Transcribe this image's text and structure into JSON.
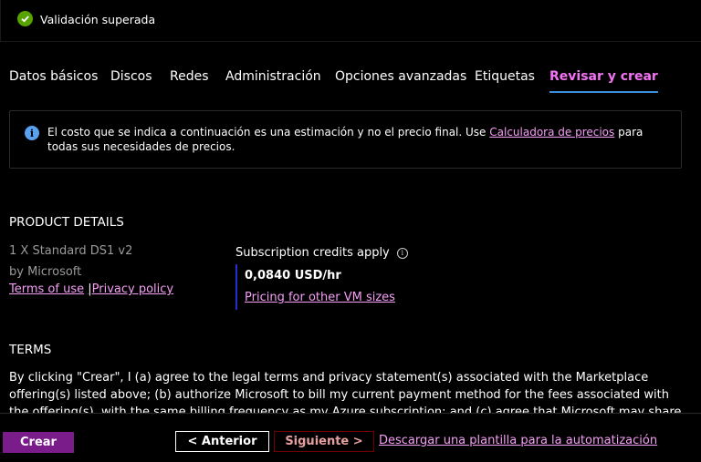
{
  "validation": {
    "text": "Validación superada",
    "color": "#57a300"
  },
  "tabs": [
    {
      "label": "Datos básicos"
    },
    {
      "label": "Discos"
    },
    {
      "label": "Redes"
    },
    {
      "label": "Administración"
    },
    {
      "label": "Opciones avanzadas"
    },
    {
      "label": "Etiquetas"
    },
    {
      "label": "Revisar y crear",
      "active": true
    }
  ],
  "info": {
    "text_before": "El costo que se indica a continuación es una estimación y no el precio final. Use ",
    "link": "Calculadora de precios",
    "text_after": " para todas sus necesidades de precios."
  },
  "product": {
    "section_title": "PRODUCT DETAILS",
    "name": "1 X Standard DS1 v2",
    "publisher": "by Microsoft",
    "terms_link": "Terms of use",
    "separator": "|",
    "privacy_link": "Privacy policy",
    "credits_label": "Subscription credits apply",
    "price": "0,0840 USD/hr",
    "pricing_link": "Pricing for other VM sizes"
  },
  "terms": {
    "section_title": "TERMS",
    "text": "By clicking \"Crear\", I (a) agree to the legal terms and privacy statement(s) associated with the Marketplace offering(s) listed above; (b) authorize Microsoft to bill my current payment method for the fees associated with the offering(s), with the same billing frequency as my Azure subscription; and (c) agree that Microsoft may share my contact, usage and transactional"
  },
  "footer": {
    "create_label": "Crear",
    "prev_label": "< Anterior",
    "next_label": "Siguiente >",
    "download_link": "Descargar una plantilla para la automatización"
  },
  "colors": {
    "accent": "#f472f4",
    "link": "#f69ef6",
    "tab_underline": "#3b8ed8",
    "create_button": "#7a1c8a"
  }
}
